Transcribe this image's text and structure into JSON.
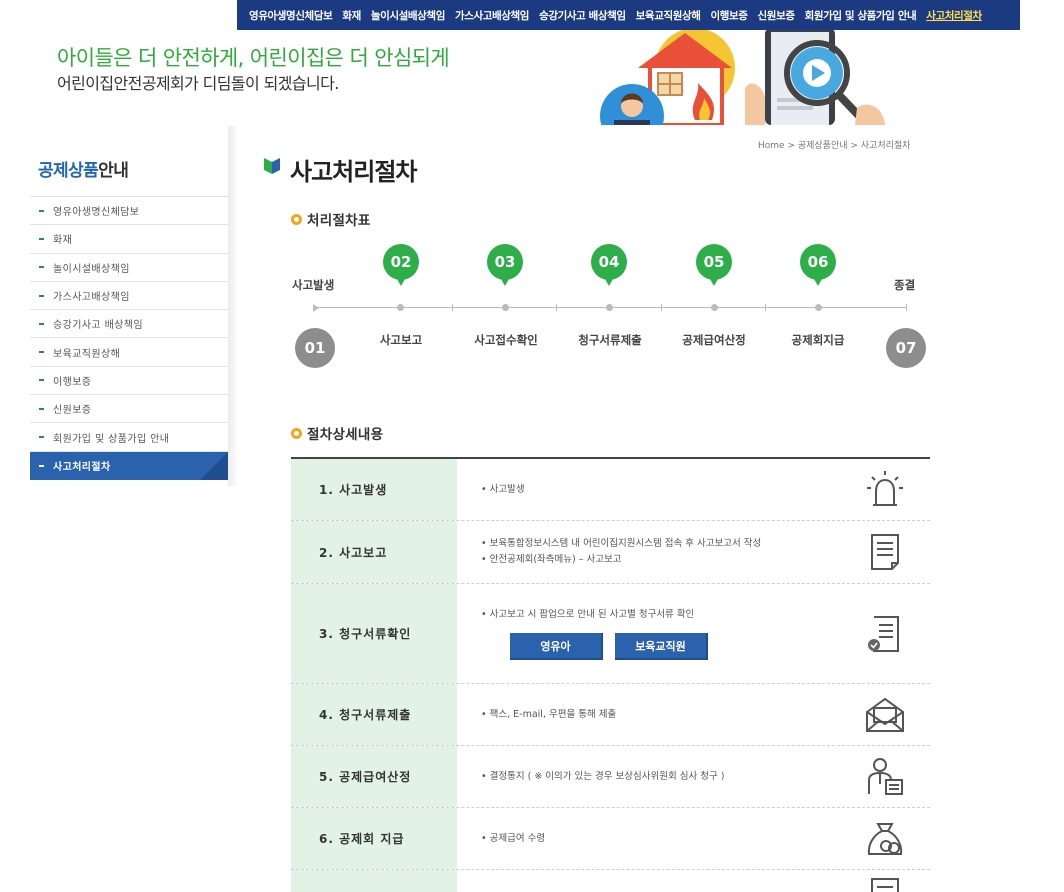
{
  "topnav": {
    "items": [
      {
        "label": "영유아생명신체담보"
      },
      {
        "label": "화재"
      },
      {
        "label": "놀이시설배상책임"
      },
      {
        "label": "가스사고배상책임"
      },
      {
        "label": "승강기사고 배상책임"
      },
      {
        "label": "보육교직원상해"
      },
      {
        "label": "이행보증"
      },
      {
        "label": "신원보증"
      },
      {
        "label": "회원가입 및 상품가입 안내"
      },
      {
        "label": "사고처리절차"
      }
    ]
  },
  "banner": {
    "line1": "아이들은 더 안전하게, 어린이집은 더 안심되게",
    "line2": "어린이집안전공제회가 디딤돌이 되겠습니다."
  },
  "sidebar": {
    "title_blue": "공제상품",
    "title_rest": "안내",
    "items": [
      {
        "label": "영유아생명신체담보"
      },
      {
        "label": "화재"
      },
      {
        "label": "놀이시설배상책임"
      },
      {
        "label": "가스사고배상책임"
      },
      {
        "label": "승강기사고 배상책임"
      },
      {
        "label": "보육교직원상해"
      },
      {
        "label": "이행보증"
      },
      {
        "label": "신원보증"
      },
      {
        "label": "회원가입 및 상품가입 안내"
      },
      {
        "label": "사고처리절차"
      }
    ]
  },
  "breadcrumb": "Home > 공제상품안내 > 사고처리절차",
  "page_title": "사고처리절차",
  "flow": {
    "section_title": "처리절차표",
    "start_label": "사고발생",
    "end_label": "종결",
    "start_num": "01",
    "end_num": "07",
    "steps": [
      {
        "num": "02",
        "label": "사고보고"
      },
      {
        "num": "03",
        "label": "사고접수확인"
      },
      {
        "num": "04",
        "label": "청구서류제출"
      },
      {
        "num": "05",
        "label": "공제급여산정"
      },
      {
        "num": "06",
        "label": "공제회지급"
      }
    ]
  },
  "details": {
    "section_title": "절차상세내용",
    "rows": [
      {
        "title": "1. 사고발생",
        "lines": [
          "• 사고발생"
        ],
        "icon": "siren-icon"
      },
      {
        "title": "2. 사고보고",
        "lines": [
          "• 보육통합정보시스템 내 어린이집지원시스템 접속 후 사고보고서 작성",
          "• 안전공제회(좌측메뉴) – 사고보고"
        ],
        "icon": "document-icon"
      },
      {
        "title": "3. 청구서류확인",
        "lines": [
          "• 사고보고 시 팝업으로 안내 된 사고별 청구서류 확인"
        ],
        "icon": "checked-document-icon",
        "buttons": [
          "영유아",
          "보육교직원"
        ]
      },
      {
        "title": "4. 청구서류제출",
        "lines": [
          "• 팩스, E-mail, 우편을 통해 제출"
        ],
        "icon": "mail-icon"
      },
      {
        "title": "5. 공제급여산정",
        "lines": [
          "• 결정통지 ( ※ 이의가 있는 경우 보상심사위원회 심사 청구 )"
        ],
        "icon": "reviewer-icon"
      },
      {
        "title": "6. 공제회 지급",
        "lines": [
          "• 공제급여 수령"
        ],
        "icon": "money-bag-icon"
      }
    ]
  }
}
